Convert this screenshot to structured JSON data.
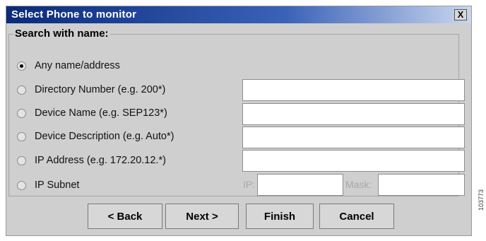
{
  "dialog": {
    "title": "Select Phone to monitor",
    "close_label": "X"
  },
  "group": {
    "legend": "Search with name:"
  },
  "options": [
    {
      "label": "Any name/address",
      "checked": true
    },
    {
      "label": "Directory Number (e.g. 200*)",
      "checked": false,
      "value": ""
    },
    {
      "label": "Device Name (e.g. SEP123*)",
      "checked": false,
      "value": ""
    },
    {
      "label": "Device Description (e.g. Auto*)",
      "checked": false,
      "value": ""
    },
    {
      "label": "IP Address (e.g. 172.20.12.*)",
      "checked": false,
      "value": ""
    },
    {
      "label": "IP Subnet",
      "checked": false
    }
  ],
  "subnet": {
    "ip_label": "IP:",
    "ip_value": "",
    "mask_label": "Mask:",
    "mask_value": ""
  },
  "buttons": {
    "back": "< Back",
    "next": "Next >",
    "finish": "Finish",
    "cancel": "Cancel"
  },
  "figure_id": "103773",
  "colors": {
    "title_start": "#0a2a7a",
    "title_end": "#c9d6ee",
    "dialog_bg": "#cfcfcf"
  }
}
